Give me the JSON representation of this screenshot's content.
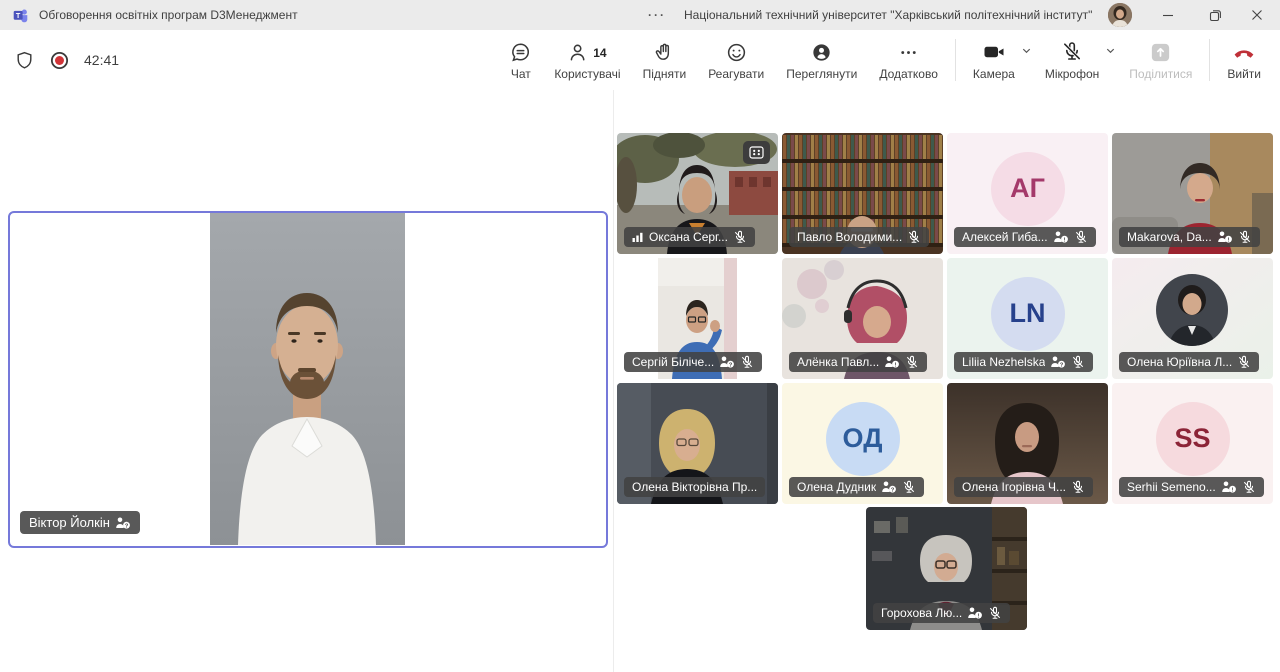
{
  "window": {
    "title": "Обговорення освітніх програм D3Менеджмент",
    "ellipsis": "···",
    "org": "Національний технічний університет \"Харківський політехнічний інститут\""
  },
  "toolbar": {
    "timer": "42:41",
    "chat": "Чат",
    "participants": "Користувачі",
    "participants_count": "14",
    "raise": "Підняти",
    "react": "Реагувати",
    "view": "Переглянути",
    "more": "Додатково",
    "camera": "Камера",
    "mic": "Мікрофон",
    "share": "Поділитися",
    "leave": "Вийти"
  },
  "colors": {
    "speaking_border": "#7579da",
    "record_red": "#d13438",
    "leave_red": "#bf3038",
    "titlebar_bg": "#ebebeb"
  },
  "stage": {
    "main": {
      "name": "Віктор Йолкін",
      "badge": "?"
    }
  },
  "grid": [
    {
      "name": "Оксана Серг...",
      "muted": true,
      "poor_connection": true
    },
    {
      "name": "Павло Володими...",
      "muted": true
    },
    {
      "name": "Алексей Гиба...",
      "initials": "АГ",
      "badge": "!",
      "muted": true
    },
    {
      "name": "Makarova, Da...",
      "badge": "!",
      "muted": true
    },
    {
      "name": "Сергій Біліче...",
      "badge": "?",
      "muted": true
    },
    {
      "name": "Алёнка Павл...",
      "badge": "!",
      "muted": true
    },
    {
      "name": "Liliia Nezhelska",
      "initials": "LN",
      "badge": "?",
      "muted": true
    },
    {
      "name": "Олена Юріївна Л...",
      "muted": true
    },
    {
      "name": "Олена Вікторівна Пр..."
    },
    {
      "name": "Олена Дудник",
      "initials": "ОД",
      "badge": "?",
      "muted": true
    },
    {
      "name": "Олена Ігорівна Ч...",
      "muted": true
    },
    {
      "name": "Serhii Semeno...",
      "initials": "SS",
      "badge": "!",
      "muted": true
    },
    {
      "name": "Горохова Лю...",
      "badge": "!",
      "muted": true
    }
  ]
}
